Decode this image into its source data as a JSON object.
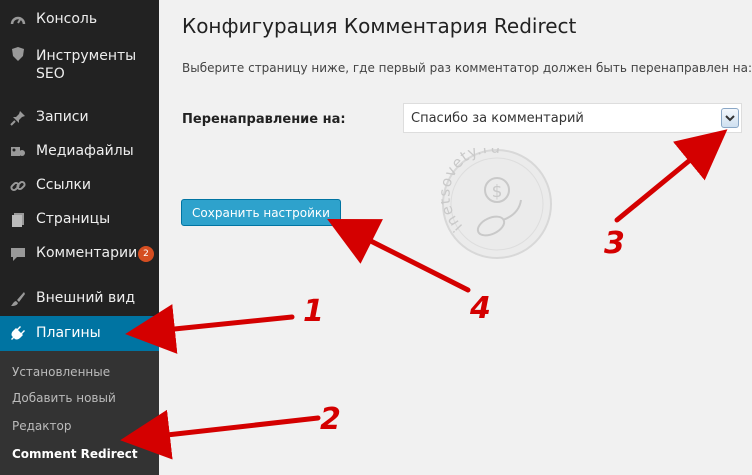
{
  "sidebar": {
    "items": [
      {
        "label": "Консоль",
        "icon": "dashboard-icon"
      },
      {
        "label": "Инструменты\nSEO",
        "label_line1": "Инструменты",
        "label_line2": "SEO",
        "icon": "shield-icon"
      },
      {
        "label": "Записи",
        "icon": "pin-icon"
      },
      {
        "label": "Медиафайлы",
        "icon": "media-icon"
      },
      {
        "label": "Ссылки",
        "icon": "link-icon"
      },
      {
        "label": "Страницы",
        "icon": "page-icon"
      },
      {
        "label": "Комментарии",
        "icon": "comment-icon",
        "badge": "2"
      },
      {
        "label": "Внешний вид",
        "icon": "brush-icon"
      },
      {
        "label": "Плагины",
        "icon": "plugin-icon",
        "active": true
      }
    ],
    "submenu": [
      "Установленные",
      "Добавить новый",
      "Редактор",
      "Comment Redirect"
    ]
  },
  "main": {
    "title": "Конфигурация Комментария Redirect",
    "description": "Выберите страницу ниже, где первый раз комментатор должен быть перенаправлен на:",
    "redirect_label": "Перенаправление на:",
    "redirect_value": "Спасибо за комментарий",
    "save_label": "Сохранить настройки"
  },
  "watermark": {
    "text": "inetsovety.ru",
    "symbol": "$"
  },
  "annotations": [
    "1",
    "2",
    "3",
    "4"
  ],
  "colors": {
    "sidebar_bg": "#222222",
    "active_bg": "#0074a2",
    "button_bg": "#2ea2cc",
    "badge_bg": "#d54e21",
    "arrow_red": "#d40000"
  }
}
